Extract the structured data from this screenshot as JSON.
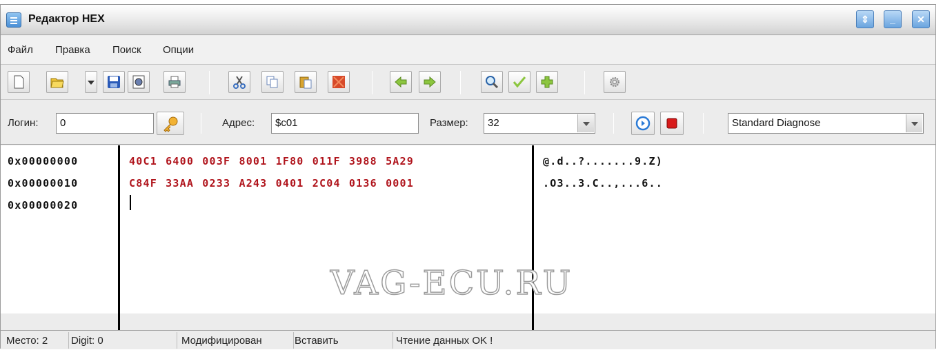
{
  "window": {
    "title": "Редактор HEX"
  },
  "menu": [
    "Файл",
    "Правка",
    "Поиск",
    "Опции"
  ],
  "toolbar": {
    "icons": [
      "new-file",
      "open-folder",
      "dropdown",
      "save",
      "preview",
      "print",
      "cut",
      "copy",
      "paste",
      "clear",
      "back-arrow",
      "forward-arrow",
      "search",
      "checkmark",
      "add",
      "settings"
    ]
  },
  "addrbar": {
    "login_label": "Логин:",
    "login_value": "0",
    "address_label": "Адрес:",
    "address_value": "$c01",
    "size_label": "Размер:",
    "size_value": "32",
    "mode_value": "Standard Diagnose"
  },
  "editor": {
    "rows": [
      {
        "addr": "0x00000000",
        "hex": "40C1 6400 003F 8001 1F80 011F 3988 5A29",
        "ascii": "@.d..?.......9.Z)"
      },
      {
        "addr": "0x00000010",
        "hex": "C84F 33AA 0233 A243 0401 2C04 0136 0001",
        "ascii": ".O3..3.C..,...6.."
      },
      {
        "addr": "0x00000020",
        "hex": "",
        "ascii": ""
      }
    ],
    "watermark": "VAG-ECU.RU"
  },
  "status": {
    "place": "Место: 2",
    "digit": "Digit: 0",
    "modified": "Модифицирован",
    "insert": "Вставить",
    "message": "Чтение данных OK !"
  },
  "colors": {
    "hex_text": "#b0141c",
    "title_bar": "#e6e6e6",
    "window_buttons": "#6aa4df"
  }
}
